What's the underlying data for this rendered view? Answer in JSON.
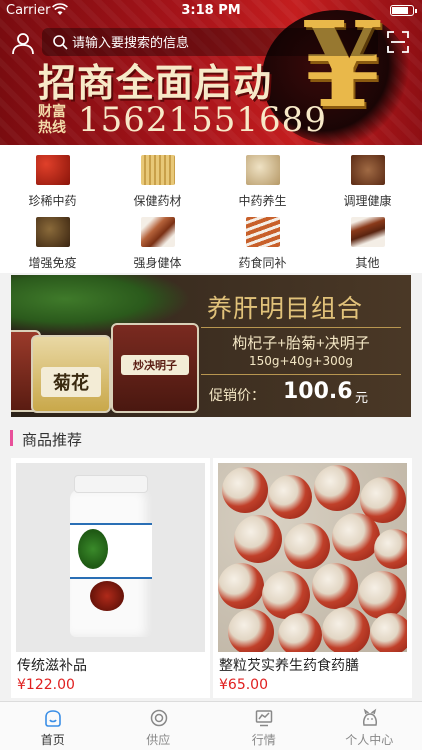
{
  "status_bar": {
    "carrier": "Carrier",
    "time": "3:18 PM"
  },
  "search": {
    "placeholder": "请输入要搜索的信息"
  },
  "hero": {
    "headline": "招商全面启动",
    "hotline_label": "财富热线",
    "hotline_number": "15621551689",
    "symbol": "¥"
  },
  "categories": [
    {
      "label": "珍稀中药",
      "color": "#b8281c"
    },
    {
      "label": "保健药材",
      "color": "#d9b46a"
    },
    {
      "label": "中药养生",
      "color": "#c9b18a"
    },
    {
      "label": "调理健康",
      "color": "#8a4a2a"
    },
    {
      "label": "增强免疫",
      "color": "#6a4a22"
    },
    {
      "label": "强身健体",
      "color": "#a05a3a"
    },
    {
      "label": "药食同补",
      "color": "#b2542a"
    },
    {
      "label": "其他",
      "color": "#7a3a1a"
    }
  ],
  "promo": {
    "title": "养肝明目组合",
    "formula": "枸杞子+胎菊+决明子",
    "weights": "150g+40g+300g",
    "price_label": "促销价：",
    "price": "100.6",
    "price_unit": "元",
    "jar1_label": "菊花",
    "jar2_label": "炒决明子"
  },
  "section": {
    "title": "商品推荐",
    "accent": "#e8509a"
  },
  "products": [
    {
      "name": "传统滋补品",
      "price": "¥122.00"
    },
    {
      "name": "整粒芡实养生药食药膳",
      "price": "¥65.00"
    }
  ],
  "tabs": [
    {
      "label": "首页",
      "icon": "home-icon",
      "active": true
    },
    {
      "label": "供应",
      "icon": "supply-icon",
      "active": false
    },
    {
      "label": "行情",
      "icon": "market-icon",
      "active": false
    },
    {
      "label": "个人中心",
      "icon": "profile-icon",
      "active": false
    }
  ],
  "colors": {
    "brand_red": "#a8141a",
    "price_red": "#e02020",
    "active_tab": "#3a8ee6"
  }
}
